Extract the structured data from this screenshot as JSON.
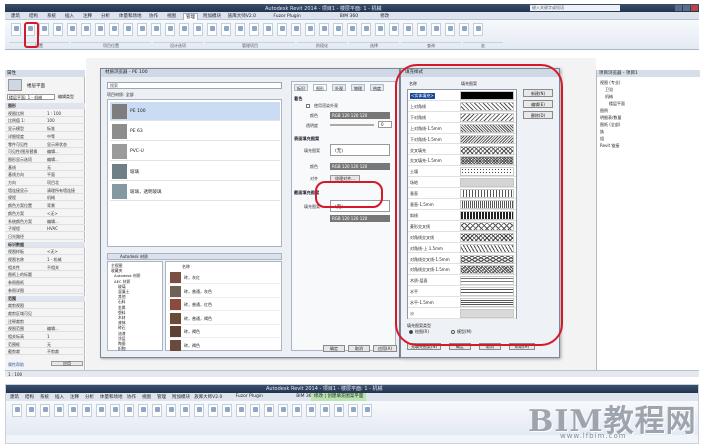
{
  "app": {
    "title": "Autodesk Revit 2014 - 项目1 - 楼层平面: 1 - 机械",
    "search_placeholder": "键入关键字或短语"
  },
  "menu_tabs": [
    "建筑",
    "结构",
    "系统",
    "插入",
    "注释",
    "分析",
    "体量和场地",
    "协作",
    "视图",
    "管理",
    "附加模块",
    "族库大师V2.0",
    "Fuzor Plugin",
    "BIM 360",
    "修改"
  ],
  "active_menu_tab": "管理",
  "ribbon_groups": [
    "设置",
    "项目位置",
    "设计选项",
    "管理项目",
    "阶段化",
    "选择",
    "查询",
    "宏"
  ],
  "properties": {
    "header": "属性",
    "type_name": "楼层平面",
    "view_selector": "楼层平面: 1 - 机械",
    "edit_type": "编辑类型",
    "rows": [
      {
        "k": "图形",
        "v": "",
        "section": true
      },
      {
        "k": "视图比例",
        "v": "1 : 100"
      },
      {
        "k": "比例值 1:",
        "v": "100"
      },
      {
        "k": "显示模型",
        "v": "标准"
      },
      {
        "k": "详细程度",
        "v": "中等"
      },
      {
        "k": "零件可见性",
        "v": "显示原状态"
      },
      {
        "k": "可见性/图形替换",
        "v": "编辑..."
      },
      {
        "k": "图形显示选项",
        "v": "编辑..."
      },
      {
        "k": "基线",
        "v": "无"
      },
      {
        "k": "基线方向",
        "v": "平面"
      },
      {
        "k": "方向",
        "v": "项目北"
      },
      {
        "k": "墙连接显示",
        "v": "清理所有墙连接"
      },
      {
        "k": "规程",
        "v": "机械"
      },
      {
        "k": "颜色方案位置",
        "v": "背景"
      },
      {
        "k": "颜色方案",
        "v": "<无>"
      },
      {
        "k": "系统颜色方案",
        "v": "编辑..."
      },
      {
        "k": "子规程",
        "v": "HVAC"
      },
      {
        "k": "日光路径",
        "v": ""
      },
      {
        "k": "标识数据",
        "v": "",
        "section": true
      },
      {
        "k": "视图样板",
        "v": "<无>"
      },
      {
        "k": "视图名称",
        "v": "1 - 机械"
      },
      {
        "k": "相关性",
        "v": "不相关"
      },
      {
        "k": "图纸上的标题",
        "v": ""
      },
      {
        "k": "参照图纸",
        "v": ""
      },
      {
        "k": "参照详图",
        "v": ""
      },
      {
        "k": "范围",
        "v": "",
        "section": true
      },
      {
        "k": "裁剪视图",
        "v": ""
      },
      {
        "k": "裁剪区域可见",
        "v": ""
      },
      {
        "k": "注释裁剪",
        "v": ""
      },
      {
        "k": "视图范围",
        "v": "编辑..."
      },
      {
        "k": "相关标高",
        "v": "1"
      },
      {
        "k": "范围框",
        "v": "无"
      },
      {
        "k": "截剪裁",
        "v": "不剪裁"
      }
    ],
    "help_link": "属性帮助",
    "apply": "应用"
  },
  "material_browser": {
    "title": "材质浏览器 - PE 100",
    "search_placeholder": "搜索",
    "filter_label": "项目材质: 全部",
    "materials": [
      {
        "name": "PE 100",
        "color": "#7d7d7d"
      },
      {
        "name": "PE 63",
        "color": "#8d8d8d"
      },
      {
        "name": "PVC-U",
        "color": "#9a9a9a"
      },
      {
        "name": "玻璃",
        "color": "#6f7f88"
      },
      {
        "name": "玻璃，透明玻璃",
        "color": "#8599a3"
      }
    ],
    "library_header": "Autodesk 材质",
    "library_tree": [
      "主视图",
      "收藏夹",
      "Autodesk 材质",
      "AEC 材质",
      "玻璃",
      "混凝土",
      "其他",
      "石料",
      "金属",
      "塑料",
      "木材",
      "液体",
      "砖石",
      "油漆",
      "涂层",
      "陶瓷",
      "织物"
    ],
    "library_name_header": "名称",
    "library_items": [
      {
        "name": "砖，灰红",
        "color": "#7a4f3f"
      },
      {
        "name": "砖，普通，灰色",
        "color": "#6e6258"
      },
      {
        "name": "砖，普通，红色",
        "color": "#8a4b3a"
      },
      {
        "name": "砖，普通，褐色",
        "color": "#6b4a38"
      },
      {
        "name": "砖，褐色",
        "color": "#5e4234"
      },
      {
        "name": "砖，褐色",
        "color": "#6a4a3c"
      }
    ],
    "editor_tabs": [
      "标识",
      "图形",
      "外观",
      "物理",
      "热度"
    ],
    "active_editor_tab": "图形",
    "shading_section": "着色",
    "use_render_appearance": "使用渲染外观",
    "color_label": "颜色",
    "color_value": "RGB 120 120 120",
    "transparency_label": "透明度",
    "transparency_value": "0",
    "surface_pattern_section": "表面填充图案",
    "fill_pattern_label": "填充图案",
    "fill_pattern_value": "(无)",
    "alignment_label": "对齐",
    "alignment_value": "纹理对齐...",
    "cut_pattern_section": "截面填充图案",
    "cut_color_value": "RGB 120 120 120",
    "ok": "确定",
    "cancel": "取消",
    "apply": "应用(A)"
  },
  "fill_dialog": {
    "title": "填充样式",
    "col_name": "名称",
    "col_pattern": "填充图案",
    "patterns": [
      "<实体填充>",
      "上对角线",
      "下对角线",
      "上对角线-1.5mm",
      "下对角线-1.5mm",
      "交叉填充",
      "交叉填充-1.5mm",
      "土壤",
      "场地",
      "垂直",
      "垂直-1.5mm",
      "斜线",
      "菱形交叉线",
      "对角线交叉线",
      "对角线-上 1.5mm",
      "对角线交叉线-1.5mm",
      "对角线交叉线-1.5mm",
      "木质-层面",
      "水平",
      "水平-1.5mm",
      "沙"
    ],
    "buttons": [
      "新建(N)",
      "编辑(E)",
      "删除(D)"
    ],
    "pattern_type_label": "填充图案类型",
    "drafting": "绘图(R)",
    "model": "模型(M)",
    "bottom_buttons": [
      "无填充图案(N)",
      "确定",
      "取消",
      "帮助(H)"
    ]
  },
  "project_browser": {
    "header": "项目浏览器 - 项目1",
    "items": [
      "视图 (专业)",
      "卫浴",
      "机械",
      "楼层平面",
      "图例",
      "明细表/数量",
      "图纸 (全部)",
      "族",
      "组",
      "Revit 链接"
    ]
  },
  "status_bar": {
    "scale": "1 : 100"
  },
  "second_window": {
    "title": "Autodesk Revit 2014 - 项目1 - 楼层平面: 1 - 机械",
    "context_tab": "修改 | 创建填充图案平面",
    "tabs": [
      "建筑",
      "结构",
      "系统",
      "插入",
      "注释",
      "分析",
      "体量和场地",
      "协作",
      "视图",
      "管理",
      "附加模块",
      "族库大师V2.0",
      "Fuzor Plugin",
      "BIM 360"
    ]
  },
  "watermark": {
    "main": "BIM教程网",
    "url": "www.lfbim.com"
  }
}
